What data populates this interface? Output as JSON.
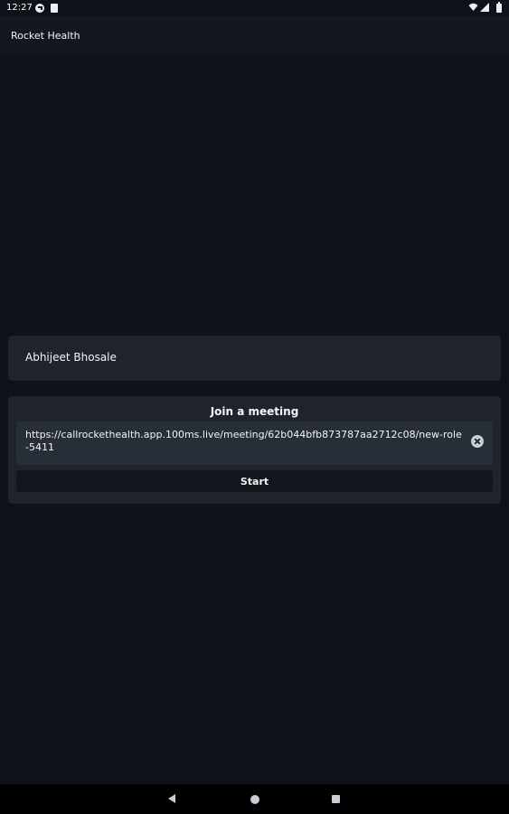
{
  "status_bar": {
    "time": "12:27"
  },
  "app_bar": {
    "title": "Rocket Health"
  },
  "name_card": {
    "name_value": "Abhijeet Bhosale"
  },
  "join_card": {
    "title": "Join a meeting",
    "url_value": "https://callrockethealth.app.100ms.live/meeting/62b044bfb873787aa2712c08/new-role-5411",
    "start_label": "Start"
  },
  "icons": {
    "status_left": [
      "app-notification-icon",
      "sd-card-icon"
    ],
    "status_right": [
      "wifi-icon",
      "cell-signal-icon",
      "battery-icon"
    ],
    "clear": "clear-icon",
    "nav": [
      "back-icon",
      "home-icon",
      "recents-icon"
    ]
  },
  "colors": {
    "background": "#0d1118",
    "app_bar": "#131820",
    "card": "#1f242c",
    "input": "#282e37",
    "button": "#12161d",
    "text": "#f2f4f7"
  }
}
